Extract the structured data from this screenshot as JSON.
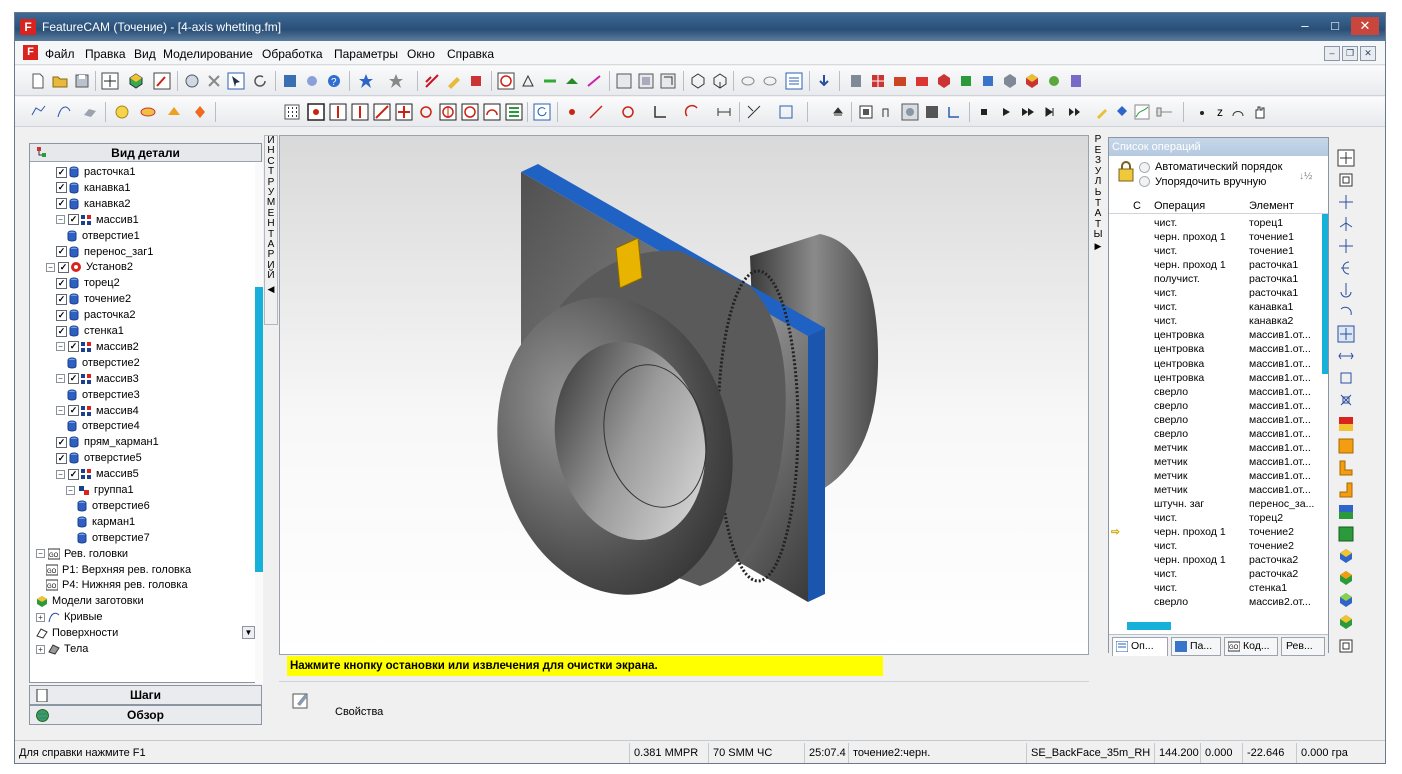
{
  "window": {
    "title": "FeatureCAM (Точение) - [4-axis whetting.fm]",
    "logo": "F",
    "min": "–",
    "max": "□",
    "close": "✕"
  },
  "menu": {
    "items": [
      "Файл",
      "Правка",
      "Вид",
      "Моделирование",
      "Обработка",
      "Параметры",
      "Окно",
      "Справка"
    ],
    "mdi_min": "–",
    "mdi_restore": "❐",
    "mdi_close": "✕"
  },
  "tree": {
    "header": "Вид детали",
    "rows": [
      {
        "label": "расточка1",
        "level": 2,
        "icon": "cylinder-icon",
        "check": true
      },
      {
        "label": "канавка1",
        "level": 2,
        "icon": "cylinder-icon",
        "check": true
      },
      {
        "label": "канавка2",
        "level": 2,
        "icon": "cylinder-icon",
        "check": true
      },
      {
        "label": "массив1",
        "level": 2,
        "icon": "pattern-icon",
        "check": true,
        "expand": "−"
      },
      {
        "label": "отверстие1",
        "level": 3,
        "icon": "cylinder-icon"
      },
      {
        "label": "перенос_заг1",
        "level": 2,
        "icon": "cylinder-icon",
        "check": true
      },
      {
        "label": "Установ2",
        "level": 1,
        "icon": "setup-icon",
        "check": true,
        "expand": "−"
      },
      {
        "label": "торец2",
        "level": 2,
        "icon": "cylinder-icon",
        "check": true
      },
      {
        "label": "точение2",
        "level": 2,
        "icon": "cylinder-icon",
        "check": true
      },
      {
        "label": "расточка2",
        "level": 2,
        "icon": "cylinder-icon",
        "check": true
      },
      {
        "label": "стенка1",
        "level": 2,
        "icon": "cylinder-icon",
        "check": true
      },
      {
        "label": "массив2",
        "level": 2,
        "icon": "pattern-icon",
        "check": true,
        "expand": "−"
      },
      {
        "label": "отверстие2",
        "level": 3,
        "icon": "cylinder-icon"
      },
      {
        "label": "массив3",
        "level": 2,
        "icon": "pattern-icon",
        "check": true,
        "expand": "−"
      },
      {
        "label": "отверстие3",
        "level": 3,
        "icon": "cylinder-icon"
      },
      {
        "label": "массив4",
        "level": 2,
        "icon": "pattern-icon",
        "check": true,
        "expand": "−"
      },
      {
        "label": "отверстие4",
        "level": 3,
        "icon": "cylinder-icon"
      },
      {
        "label": "прям_карман1",
        "level": 2,
        "icon": "cylinder-icon",
        "check": true
      },
      {
        "label": "отверстие5",
        "level": 2,
        "icon": "cylinder-icon",
        "check": true
      },
      {
        "label": "массив5",
        "level": 2,
        "icon": "pattern-icon",
        "check": true,
        "expand": "−"
      },
      {
        "label": "группа1",
        "level": 3,
        "icon": "group-icon",
        "expand": "−"
      },
      {
        "label": "отверстие6",
        "level": 4,
        "icon": "cylinder-icon"
      },
      {
        "label": "карман1",
        "level": 4,
        "icon": "cylinder-icon"
      },
      {
        "label": "отверстие7",
        "level": 4,
        "icon": "cylinder-icon"
      },
      {
        "label": "Рев. головки",
        "level": 0,
        "icon": "turret-icon",
        "expand": "−"
      },
      {
        "label": "P1: Верхняя рев. головка",
        "level": 1,
        "icon": "turret-icon"
      },
      {
        "label": "P4: Нижняя рев. головка",
        "level": 1,
        "icon": "turret-icon"
      },
      {
        "label": "Модели заготовки",
        "level": 0,
        "icon": "stock-model-icon"
      },
      {
        "label": "Кривые",
        "level": 0,
        "icon": "curve-icon",
        "expand": "+"
      },
      {
        "label": "Поверхности",
        "level": 0,
        "icon": "surface-icon"
      },
      {
        "label": "Тела",
        "level": 0,
        "icon": "solid-icon",
        "expand": "+"
      }
    ],
    "scroll_arrow": "▼"
  },
  "nav": {
    "steps": "Шаги",
    "overview": "Обзор"
  },
  "side_tabs": {
    "tools": "ИНСТРУМЕНТАРИЙ",
    "tools_arrow": "◀",
    "results": "РЕЗУЛЬТАТЫ",
    "results_arrow": "▶"
  },
  "ops": {
    "header": "Список операций",
    "auto_order": "Автоматический порядок",
    "manual_order": "Упорядочить вручную",
    "sort_icon": "↓½",
    "col_c": "C",
    "col_op": "Операция",
    "col_el": "Элемент",
    "rows": [
      [
        "чист.",
        "торец1"
      ],
      [
        "черн. проход 1",
        "точение1"
      ],
      [
        "чист.",
        "точение1"
      ],
      [
        "черн. проход 1",
        "расточка1"
      ],
      [
        "получист.",
        "расточка1"
      ],
      [
        "чист.",
        "расточка1"
      ],
      [
        "чист.",
        "канавка1"
      ],
      [
        "чист.",
        "канавка2"
      ],
      [
        "центровка",
        "массив1.от..."
      ],
      [
        "центровка",
        "массив1.от..."
      ],
      [
        "центровка",
        "массив1.от..."
      ],
      [
        "центровка",
        "массив1.от..."
      ],
      [
        "сверло",
        "массив1.от..."
      ],
      [
        "сверло",
        "массив1.от..."
      ],
      [
        "сверло",
        "массив1.от..."
      ],
      [
        "сверло",
        "массив1.от..."
      ],
      [
        "метчик",
        "массив1.от..."
      ],
      [
        "метчик",
        "массив1.от..."
      ],
      [
        "метчик",
        "массив1.от..."
      ],
      [
        "метчик",
        "массив1.от..."
      ],
      [
        "штучн. заг",
        "перенос_за..."
      ],
      [
        "чист.",
        "торец2"
      ],
      [
        "черн. проход 1",
        "точение2"
      ],
      [
        "чист.",
        "точение2"
      ],
      [
        "черн. проход 1",
        "расточка2"
      ],
      [
        "чист.",
        "расточка2"
      ],
      [
        "чист.",
        "стенка1"
      ],
      [
        "сверло",
        "массив2.от..."
      ]
    ],
    "current_marker": "⇨",
    "tabs": [
      "Оп...",
      "Па...",
      "Код...",
      "Рев..."
    ]
  },
  "message": "Нажмите кнопку остановки или извлечения для очистки экрана.",
  "properties_label": "Свойства",
  "status": {
    "help": "Для справки нажмите F1",
    "feed": "0.381 MMPR",
    "speed": "70 SMM  ЧС",
    "time": "25:07.4",
    "operation": "точение2:черн.",
    "tool": "SE_BackFace_35m_RH",
    "x": "144.200",
    "y": "0.000",
    "z": "-22.646",
    "last": "0.000 гра"
  },
  "toolbar_text": {
    "z_label": "z"
  }
}
